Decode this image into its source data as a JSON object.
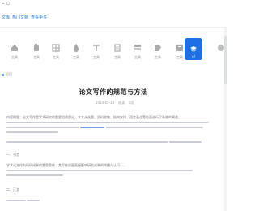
{
  "window": {
    "corner_label": "⌄ ◻"
  },
  "breadcrumb": {
    "items": [
      "文库",
      "热门文档",
      "查看更多"
    ]
  },
  "toolbar": {
    "tools": [
      {
        "name": "tool-1",
        "label": "工具",
        "icon": "home-icon"
      },
      {
        "name": "tool-2",
        "label": "工具",
        "icon": "hand-icon"
      },
      {
        "name": "tool-3",
        "label": "工具",
        "icon": "grid-icon"
      },
      {
        "name": "tool-4",
        "label": "工具",
        "icon": "drop-icon"
      },
      {
        "name": "tool-5",
        "label": "工具",
        "icon": "type-icon"
      },
      {
        "name": "tool-6",
        "label": "工具",
        "icon": "doc-icon"
      },
      {
        "name": "tool-7",
        "label": "工具",
        "icon": "layers-icon"
      },
      {
        "name": "tool-8",
        "label": "工具",
        "icon": "tag-icon"
      },
      {
        "name": "tool-9",
        "label": "AI",
        "icon": "ai-icon"
      },
      {
        "name": "tool-10",
        "label": "",
        "icon": "more-icon"
      }
    ],
    "active_index": 8
  },
  "doc": {
    "back_link": "返回",
    "title": "论文写作的规范与方法",
    "meta": [
      "2024-05-10",
      "阅读",
      "5页"
    ],
    "paragraphs": [
      "内容摘要：论文写作是学术研究的重要组成部分，本文从选题、资料收集、结构安排、语言表达等方面进行了系统的阐述，",
      "一、引言",
      "学术论文作为科研成果的重要载体，其写作质量直接影响研究成果的传播与认可……",
      "二、正文"
    ]
  },
  "colors": {
    "accent": "#1e6fe6",
    "link": "#1a6fd8"
  }
}
